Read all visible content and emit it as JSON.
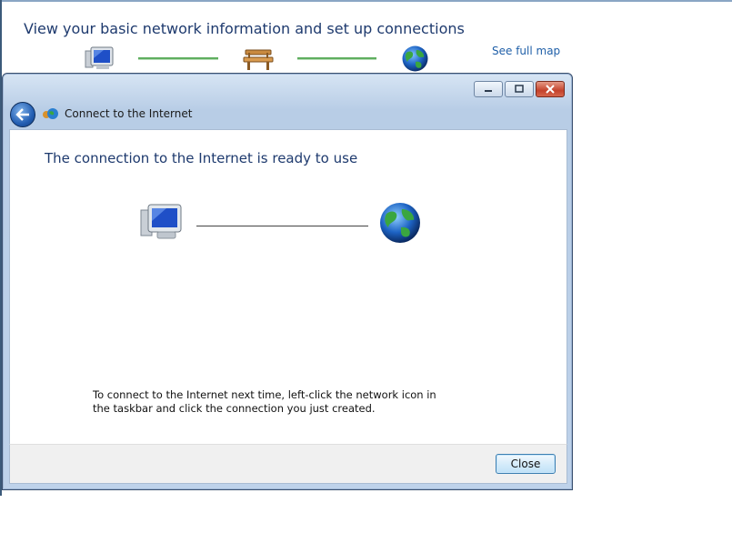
{
  "background": {
    "header": "View your basic network information and set up connections",
    "see_full_map": "See full map"
  },
  "dialog": {
    "nav_title": "Connect to the Internet",
    "headline": "The connection to the Internet is ready to use",
    "note": "To connect to the Internet next time, left-click the network icon in the taskbar and click the connection you just created.",
    "close_label": "Close"
  },
  "icons": [
    "computer-icon",
    "bench-icon",
    "globe-icon",
    "network-connection-icon",
    "minimize-icon",
    "maximize-icon",
    "close-icon",
    "back-arrow-icon"
  ]
}
